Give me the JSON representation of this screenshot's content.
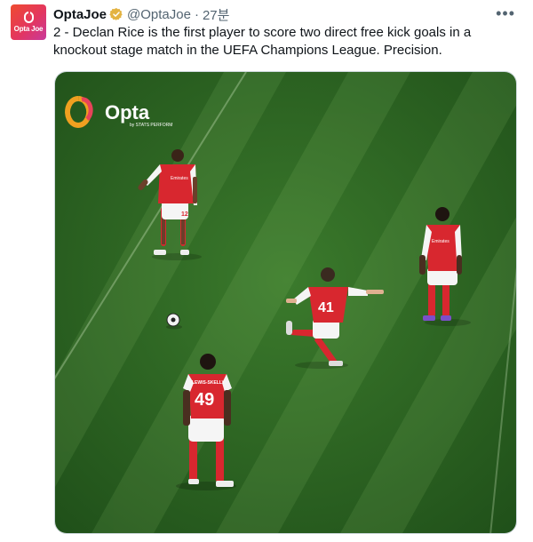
{
  "author": {
    "name": "OptaJoe",
    "handle": "@OptaJoe",
    "separator": "·",
    "time": "27분",
    "avatar_text": "Opta Joe"
  },
  "tweet_text": "2 - Declan Rice is the first player to score two direct free kick goals in a knockout stage match in the UEFA Champions League. Precision.",
  "media": {
    "watermark": "Opta",
    "watermark_sub": "by STATS PERFORM",
    "shirt_numbers": [
      "12",
      "41",
      "49"
    ],
    "shirt_name": "LEWIS-SKELLY",
    "shirt_sponsor": "Emirates"
  },
  "colors": {
    "verified": "#e3b341",
    "pitch": "#2f6a25",
    "kit_red": "#d8272f"
  },
  "icons": {
    "verified": "verified-badge-icon",
    "more": "more-options-icon"
  }
}
